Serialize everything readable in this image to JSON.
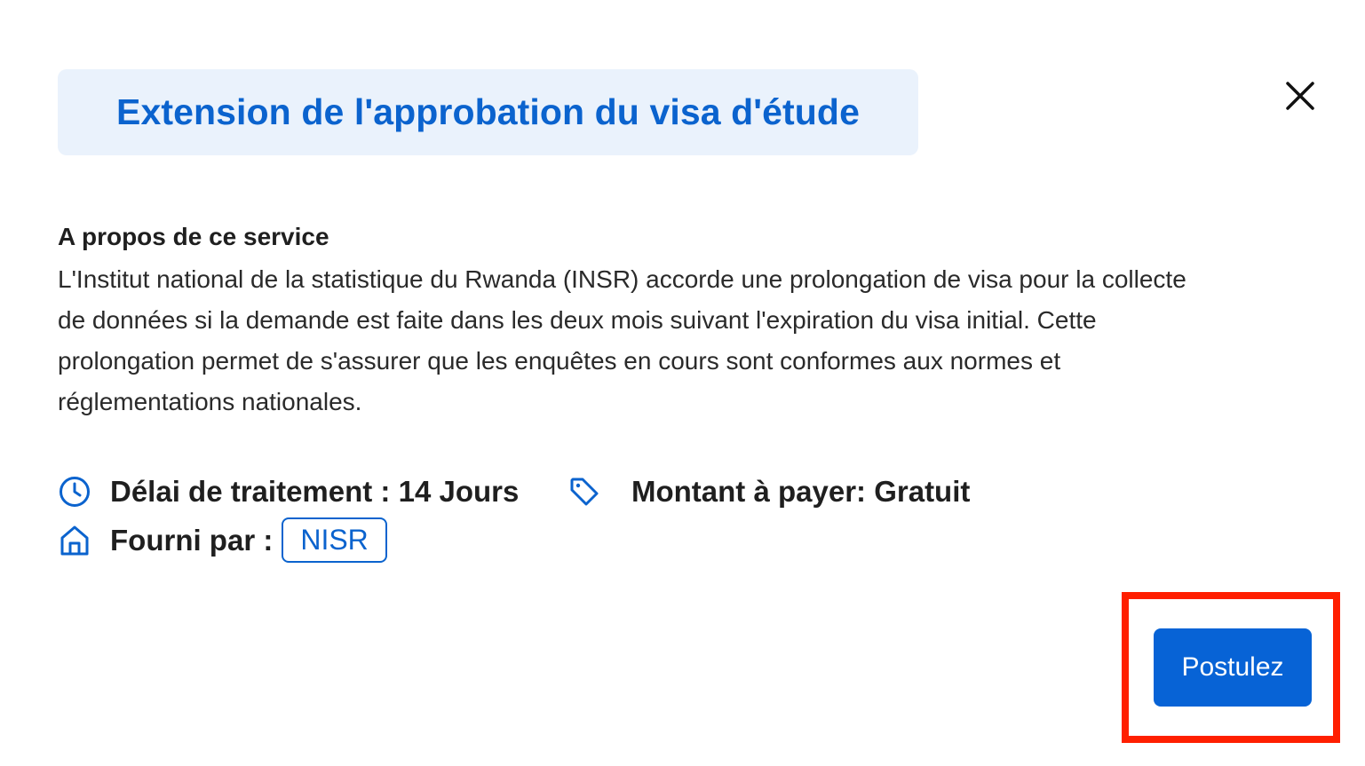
{
  "modal": {
    "title": "Extension de l'approbation du visa d'étude",
    "close_icon": "close-icon"
  },
  "about": {
    "heading": "A propos de ce service",
    "body_lines": [
      "L'Institut national de la statistique du Rwanda (INSR) accorde une prolongation de visa pour la collecte",
      "de données si la demande est faite dans les deux mois suivant l'expiration du visa initial. Cette",
      "prolongation permet de s'assurer que les enquêtes en cours sont conformes aux normes et",
      "réglementations nationales."
    ]
  },
  "details": {
    "processing_time": "Délai de traitement : 14 Jours",
    "processing_icon": "clock-icon",
    "amount": "Montant à payer: Gratuit",
    "amount_icon": "tag-icon",
    "provided_by_label": "Fourni par :",
    "provider_icon": "home-icon",
    "provider_name": "NISR"
  },
  "actions": {
    "apply_label": "Postulez"
  },
  "colors": {
    "accent": "#0b63ce",
    "title_bg": "#eaf2fc",
    "button_bg": "#0763d6",
    "highlight": "#ff1f00"
  }
}
